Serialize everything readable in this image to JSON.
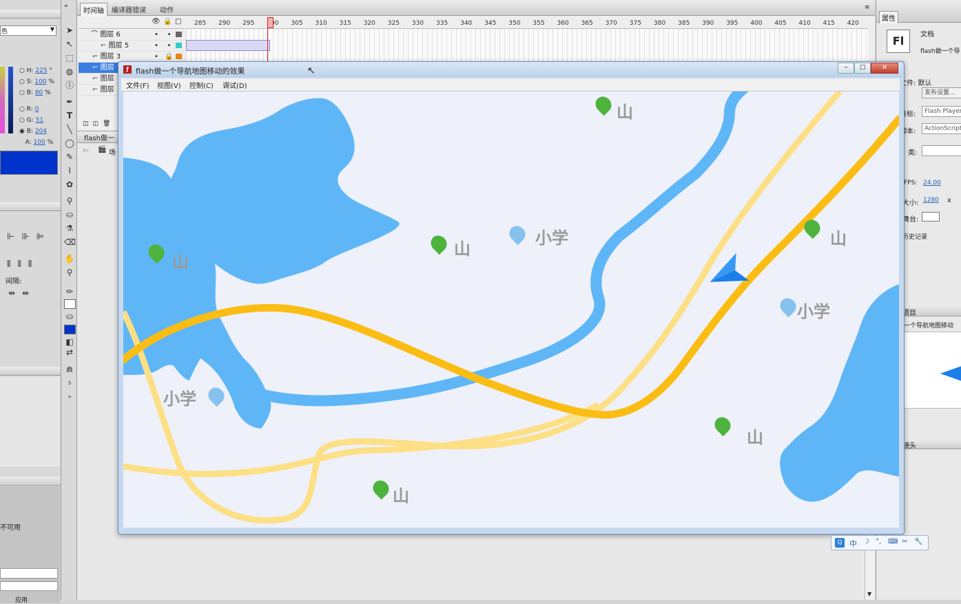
{
  "timeline_tabs": [
    "时间轴",
    "编译器错误",
    "动作"
  ],
  "ruler_ticks": [
    "285",
    "290",
    "295",
    "300",
    "305",
    "310",
    "315",
    "320",
    "325",
    "330",
    "335",
    "340",
    "345",
    "350",
    "355",
    "360",
    "365",
    "370",
    "375",
    "380",
    "385",
    "390",
    "395",
    "400",
    "405",
    "410",
    "415",
    "420"
  ],
  "layers": [
    "图层 6",
    "图层 5",
    "图层 3",
    "图层",
    "图层",
    "图层"
  ],
  "color_panel": {
    "h_label": "H:",
    "h_value": "225",
    "h_unit": "°",
    "s_label": "S:",
    "s_value": "100",
    "s_unit": "%",
    "b_label": "B:",
    "b_value": "80",
    "b_unit": "%",
    "r_label": "R:",
    "r_value": "0",
    "g_label": "G:",
    "g_value": "51",
    "b2_label": "B:",
    "b2_value": "204",
    "a_label": "A:",
    "a_value": "100",
    "a_unit": "%",
    "swatch_color": "#0033cc",
    "partial_label": "色"
  },
  "align_panel": {
    "spacing_label": "间隔:"
  },
  "left_bottom": {
    "unavailable": "不可用",
    "apply": "应用"
  },
  "scene_panel": {
    "doc_tab": "flash做一",
    "scene_label": "场"
  },
  "player": {
    "title": "flash做一个导航地图移动的效果",
    "menu": [
      "文件(F)",
      "视图(V)",
      "控制(C)",
      "调试(D)"
    ]
  },
  "map": {
    "mountain": "山",
    "school": "小学",
    "colors": {
      "water": "#5fb6f7",
      "road_main": "#fbbd14",
      "road_minor": "#fddf85",
      "land": "#eef1f9",
      "marker_green": "#4db33d"
    }
  },
  "properties": {
    "tab": "属性",
    "fl_logo": "Fl",
    "doc_label": "文档",
    "doc_name": "flash做一个导",
    "file_row": "文件: 默认",
    "publish_btn": "发布设置...",
    "target_label": "目标:",
    "target_value": "Flash Player",
    "script_label": "脚本:",
    "script_value": "ActionScript",
    "class_label": "类:",
    "fps_label": "FPS:",
    "fps_value": "24.00",
    "size_label": "大小:",
    "size_value": "1280",
    "size_x": "x",
    "stage_label": "舞台:",
    "history": "历史记录",
    "library_tab": "项目",
    "library_item": "一个导航地图移动",
    "lens_label": "镜头"
  },
  "ime_bar": [
    "中",
    "☽",
    "°,",
    "⌨",
    "✂",
    "🔧"
  ]
}
